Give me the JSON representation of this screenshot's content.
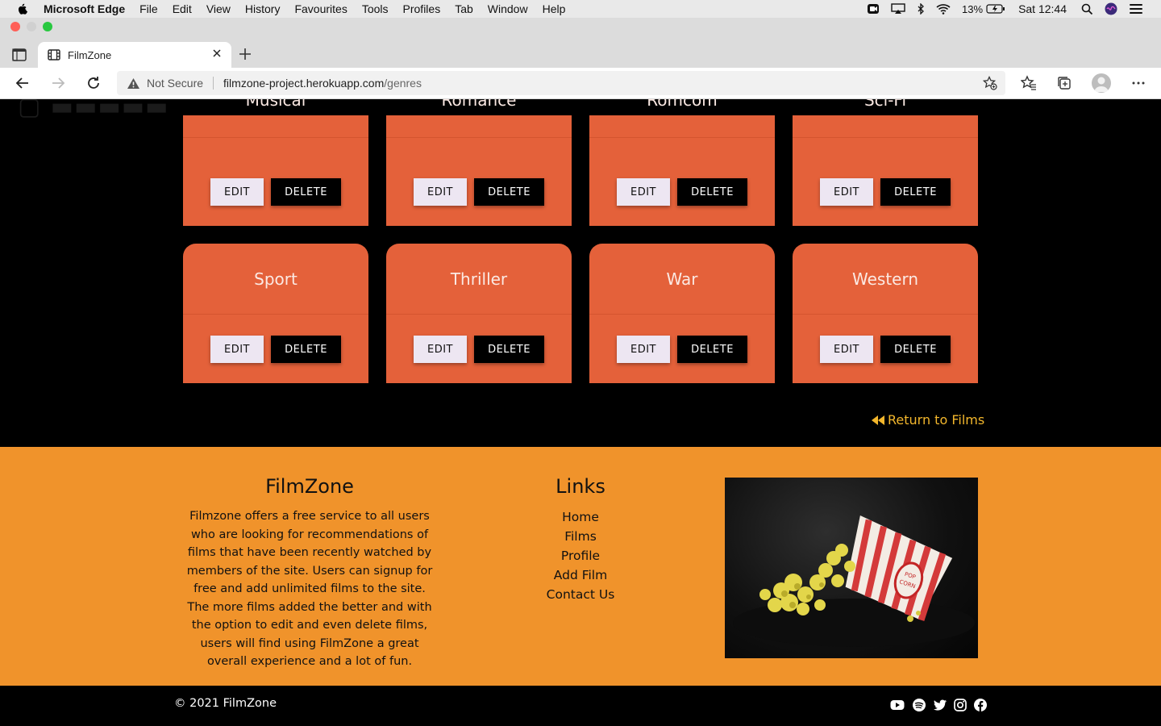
{
  "menubar": {
    "app_name": "Microsoft Edge",
    "items": [
      "File",
      "Edit",
      "View",
      "History",
      "Favourites",
      "Tools",
      "Profiles",
      "Tab",
      "Window",
      "Help"
    ],
    "battery": "13%",
    "clock": "Sat 12:44"
  },
  "browser": {
    "tab_title": "FilmZone",
    "security_label": "Not Secure",
    "url_host": "filmzone-project.herokuapp.com",
    "url_path": "/genres"
  },
  "page": {
    "genres_row1": [
      {
        "name": "Musical"
      },
      {
        "name": "Romance"
      },
      {
        "name": "Romcom"
      },
      {
        "name": "Sci-Fi"
      }
    ],
    "genres_row2": [
      {
        "name": "Sport"
      },
      {
        "name": "Thriller"
      },
      {
        "name": "War"
      },
      {
        "name": "Western"
      }
    ],
    "edit_label": "EDIT",
    "delete_label": "DELETE",
    "return_label": "Return to Films"
  },
  "footer": {
    "about_title": "FilmZone",
    "about_text": "Filmzone offers a free service to all users who are looking for recommendations of films that have been recently watched by members of the site. Users can signup for free and add unlimited films to the site. The more films added the better and with the option to edit and even delete films, users will find using FilmZone a great overall experience and a lot of fun.",
    "links_title": "Links",
    "links": [
      "Home",
      "Films",
      "Profile",
      "Add Film",
      "Contact Us"
    ],
    "copyright": "© 2021 FilmZone",
    "social": [
      "youtube-icon",
      "spotify-icon",
      "twitter-icon",
      "instagram-icon",
      "facebook-icon"
    ]
  },
  "colors": {
    "card": "#e4613a",
    "footer": "#f0932b",
    "link_accent": "#f2b62c"
  }
}
